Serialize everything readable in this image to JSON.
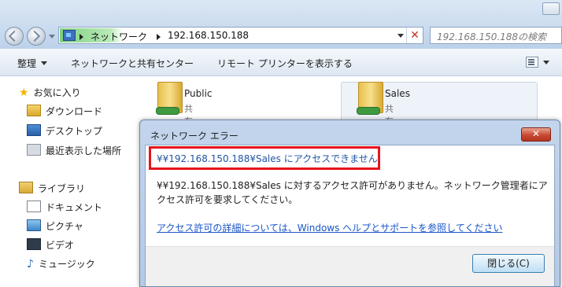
{
  "address_bar": {
    "segments": [
      "ネットワーク",
      "192.168.150.188"
    ],
    "search_placeholder": "192.168.150.188の検索"
  },
  "toolbar": {
    "organize": "整理",
    "network_center": "ネットワークと共有センター",
    "remote_printers": "リモート プリンターを表示する"
  },
  "navigation": {
    "favorites": {
      "label": "お気に入り",
      "items": [
        "ダウンロード",
        "デスクトップ",
        "最近表示した場所"
      ]
    },
    "libraries": {
      "label": "ライブラリ",
      "items": [
        "ドキュメント",
        "ピクチャ",
        "ビデオ",
        "ミュージック"
      ]
    }
  },
  "shares": [
    {
      "name": "Public",
      "subtitle": "共有"
    },
    {
      "name": "Sales",
      "subtitle": "共有"
    }
  ],
  "dialog": {
    "title": "ネットワーク エラー",
    "close_glyph": "✕",
    "heading": "¥¥192.168.150.188¥Sales にアクセスできません",
    "message": "¥¥192.168.150.188¥Sales に対するアクセス許可がありません。ネットワーク管理者にアクセス許可を要求してください。",
    "help_link": "アクセス許可の詳細については、Windows ヘルプとサポートを参照してください",
    "close_button": "閉じる(C)"
  },
  "colors": {
    "highlight_box": "#e8141d",
    "link": "#1a56c7",
    "heading_text": "#2155a3"
  }
}
